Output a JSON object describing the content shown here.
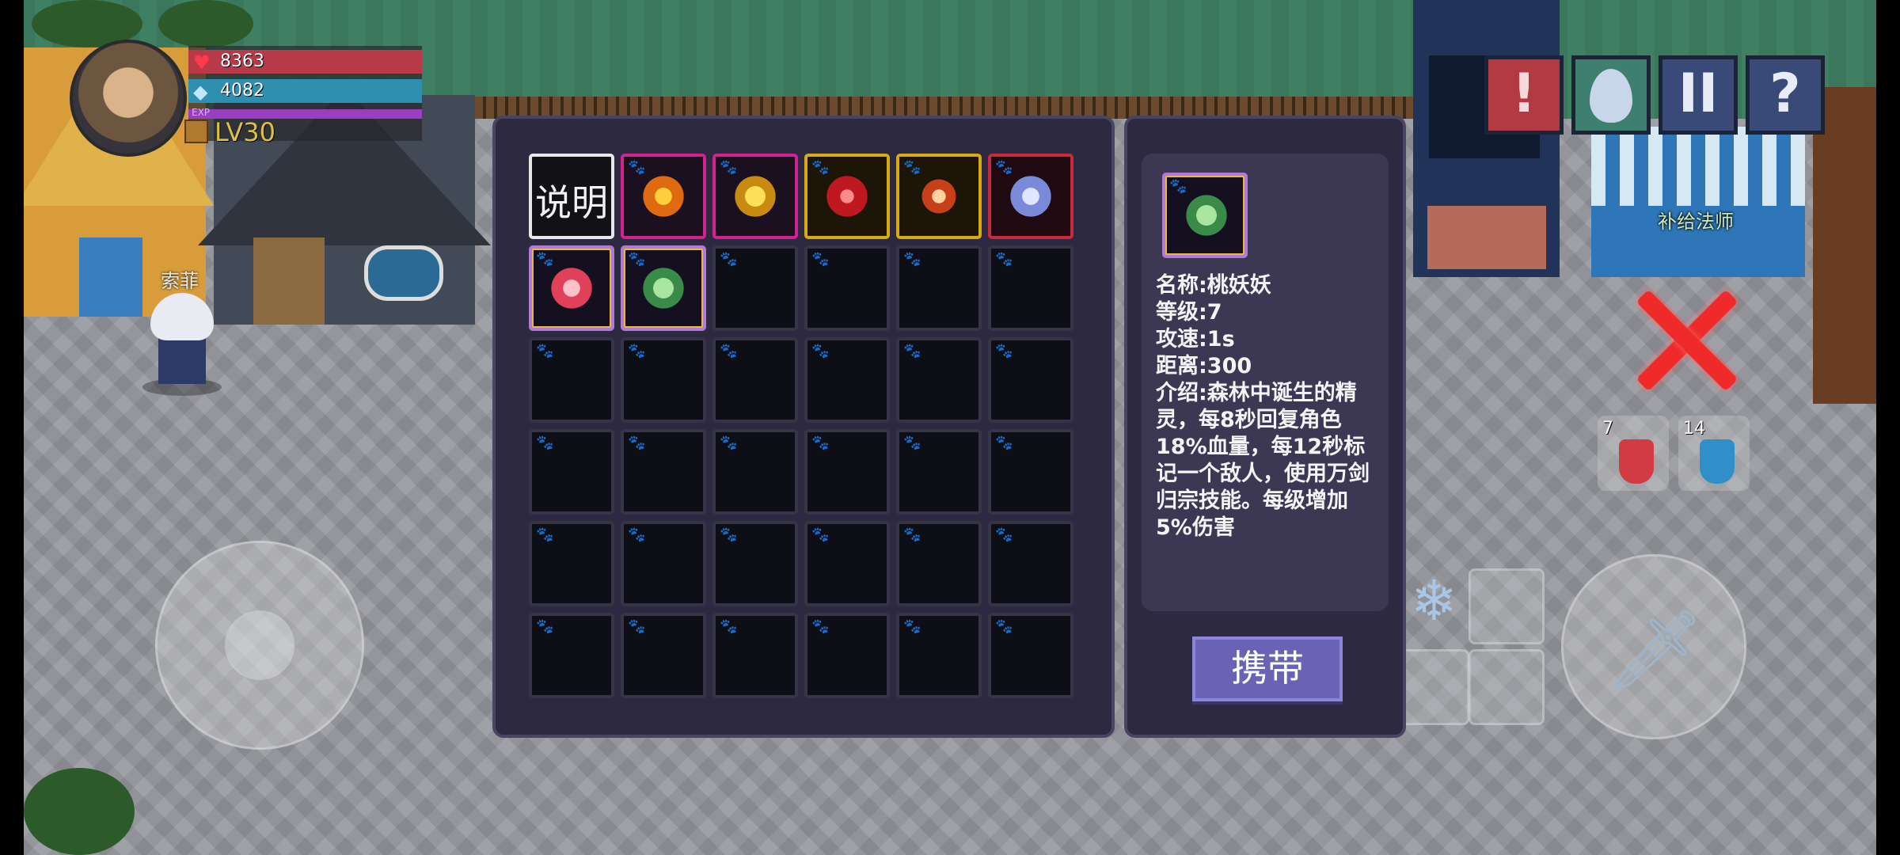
{
  "hud": {
    "hp": "8363",
    "mp": "4082",
    "exp_label": "EXP",
    "level": "LV30"
  },
  "player_name": "索菲",
  "npc_label": "补给法师",
  "top_buttons": [
    {
      "name": "alert-button",
      "symbol": "!"
    },
    {
      "name": "egg-button",
      "symbol": ""
    },
    {
      "name": "pause-button",
      "symbol": "II"
    },
    {
      "name": "help-button",
      "symbol": "?"
    }
  ],
  "potions": {
    "red_count": "7",
    "blue_count": "14"
  },
  "inventory": {
    "explain_label": "说明",
    "slots": [
      {
        "rarity": "white",
        "kind": "explain"
      },
      {
        "rarity": "pink",
        "kind": "pumpkin-pet"
      },
      {
        "rarity": "pink",
        "kind": "bee-pet"
      },
      {
        "rarity": "yellow",
        "kind": "red-orb-pet"
      },
      {
        "rarity": "yellow",
        "kind": "fire-spirit-pet"
      },
      {
        "rarity": "red",
        "kind": "ice-beast-pet"
      },
      {
        "rarity": "rainbow",
        "kind": "flame-fairy-pet"
      },
      {
        "rarity": "rainbow",
        "kind": "peach-fairy-pet"
      }
    ],
    "total_slots": 36
  },
  "detail": {
    "name_line": "名称:桃妖妖",
    "level_line": "等级:7",
    "speed_line": "攻速:1s",
    "range_line": "距离:300",
    "intro_line": "介绍:森林中诞生的精灵，每8秒回复角色18%血量，每12秒标记一个敌人，使用万剑归宗技能。每级增加5%伤害",
    "carry_label": "携带"
  },
  "colors": {
    "panel_bg": "#2c2940",
    "panel_border": "#4a4463",
    "carry_button": "#6a62b4",
    "hp_bar": "#b83a48",
    "mp_bar": "#2f8fb0",
    "exp_bar": "#9a3ec0"
  }
}
